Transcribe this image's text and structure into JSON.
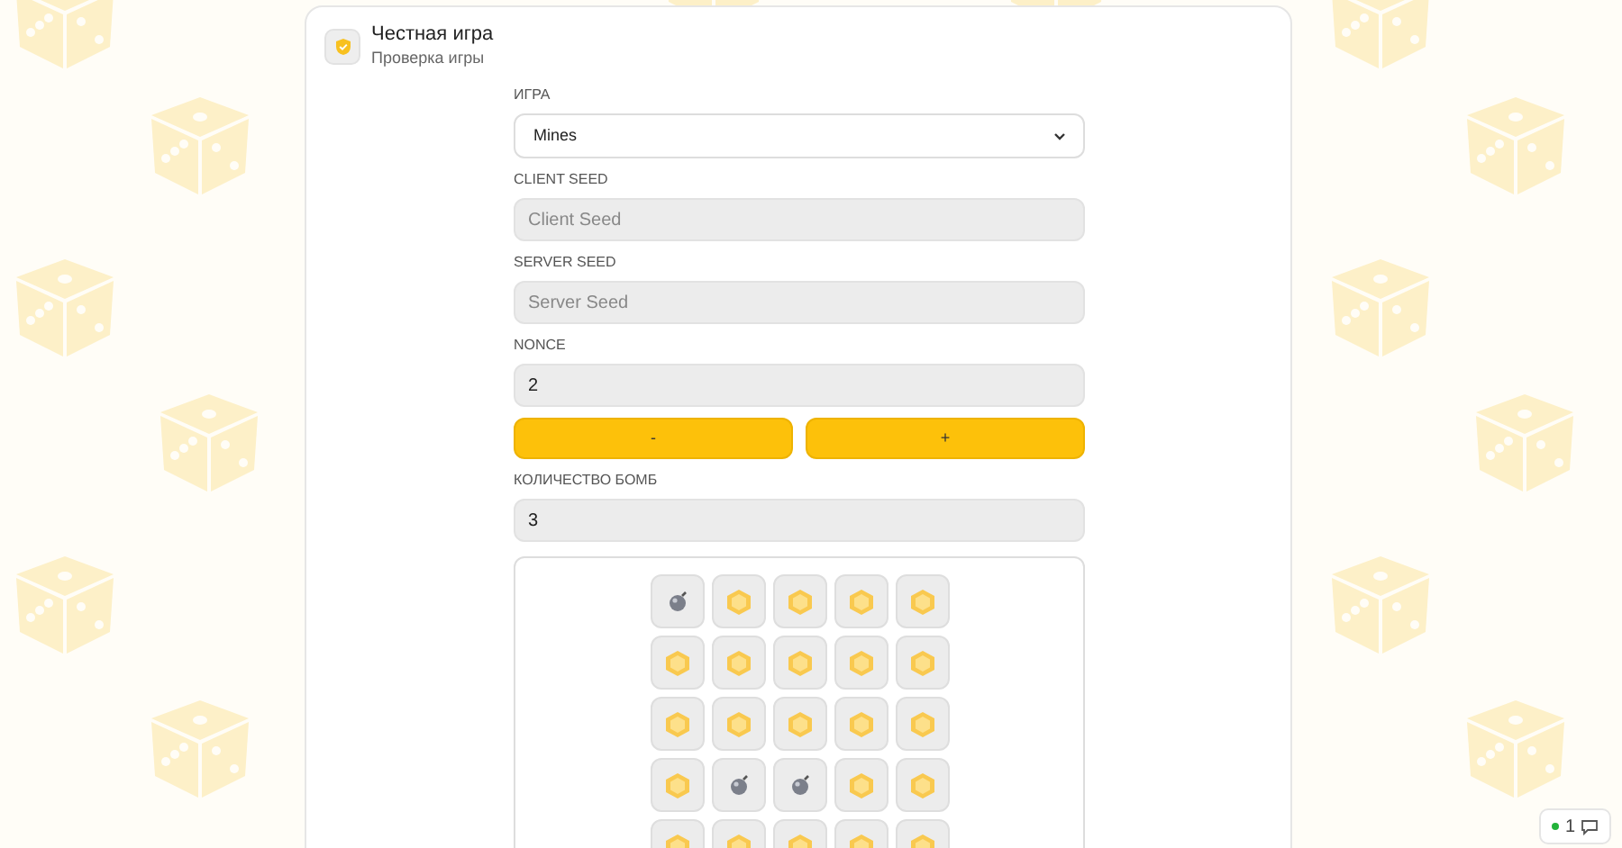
{
  "header": {
    "title": "Честная игра",
    "subtitle": "Проверка игры"
  },
  "game": {
    "label": "ИГРА",
    "value": "Mines"
  },
  "client_seed": {
    "label": "CLIENT SEED",
    "placeholder": "Client Seed"
  },
  "server_seed": {
    "label": "SERVER SEED",
    "placeholder": "Server Seed"
  },
  "nonce": {
    "label": "NONCE",
    "value": "2"
  },
  "nonce_buttons": [
    {
      "label": "-"
    },
    {
      "label": "+"
    }
  ],
  "bombs": {
    "label": "КОЛИЧЕСТВО БОМБ",
    "value": "3"
  },
  "grid": [
    [
      {
        "kind": "bomb"
      },
      {
        "kind": "gem"
      },
      {
        "kind": "gem"
      },
      {
        "kind": "gem"
      },
      {
        "kind": "gem"
      }
    ],
    [
      {
        "kind": "gem"
      },
      {
        "kind": "gem"
      },
      {
        "kind": "gem"
      },
      {
        "kind": "gem"
      },
      {
        "kind": "gem"
      }
    ],
    [
      {
        "kind": "gem"
      },
      {
        "kind": "gem"
      },
      {
        "kind": "gem"
      },
      {
        "kind": "gem"
      },
      {
        "kind": "gem"
      }
    ],
    [
      {
        "kind": "gem"
      },
      {
        "kind": "bomb"
      },
      {
        "kind": "bomb"
      },
      {
        "kind": "gem"
      },
      {
        "kind": "gem"
      }
    ],
    [
      {
        "kind": "gem"
      },
      {
        "kind": "gem"
      },
      {
        "kind": "gem"
      },
      {
        "kind": "gem"
      },
      {
        "kind": "gem"
      }
    ]
  ],
  "chat_widget": {
    "count": "1"
  }
}
